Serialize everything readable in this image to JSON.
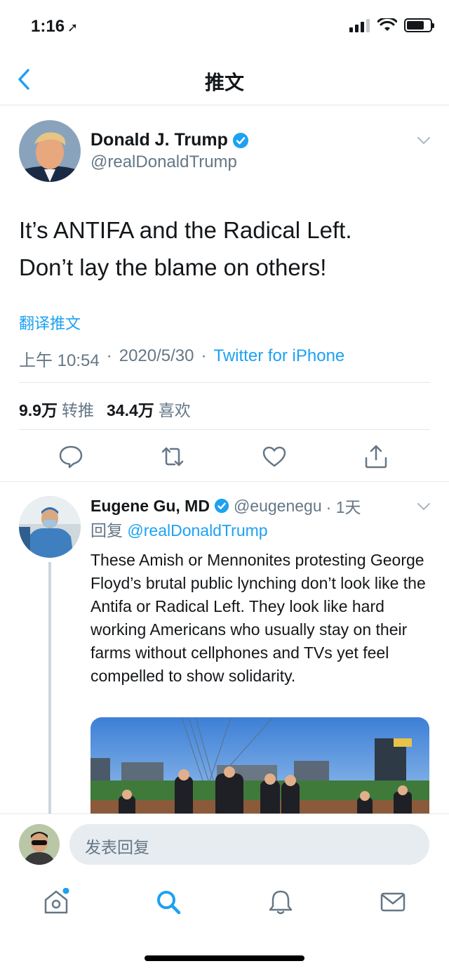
{
  "status_bar": {
    "time": "1:16",
    "location_glyph": "➚"
  },
  "nav": {
    "title": "推文",
    "back_icon": "chevron-left-icon"
  },
  "main_tweet": {
    "author_name": "Donald J. Trump",
    "author_handle": "@realDonaldTrump",
    "verified": true,
    "text_line1": "It’s ANTIFA and the Radical Left.",
    "text_line2": "Don’t lay the blame on others!",
    "translate_label": "翻译推文",
    "time": "上午 10:54",
    "date": "2020/5/30",
    "separator": "·",
    "source": "Twitter for iPhone",
    "retweets_count": "9.9万",
    "retweets_label": "转推",
    "likes_count": "34.4万",
    "likes_label": "喜欢"
  },
  "reply_tweet": {
    "author_name": "Eugene Gu, MD",
    "author_handle": "@eugenegu",
    "time_ago": "· 1天",
    "reply_prefix": "回复",
    "reply_to": "@realDonaldTrump",
    "text": "These Amish or Mennonites protesting George Floyd’s brutal public lynching don’t look like the Antifa or Radical Left. They look like hard working Americans who usually stay on their farms without cellphones and TVs yet feel compelled to show solidarity."
  },
  "composer": {
    "placeholder": "发表回复"
  },
  "tabs": [
    "home-icon",
    "search-icon",
    "notifications-icon",
    "messages-icon"
  ],
  "colors": {
    "accent": "#1da1f2",
    "secondary_text": "#657786",
    "divider": "#e1e8ed"
  }
}
